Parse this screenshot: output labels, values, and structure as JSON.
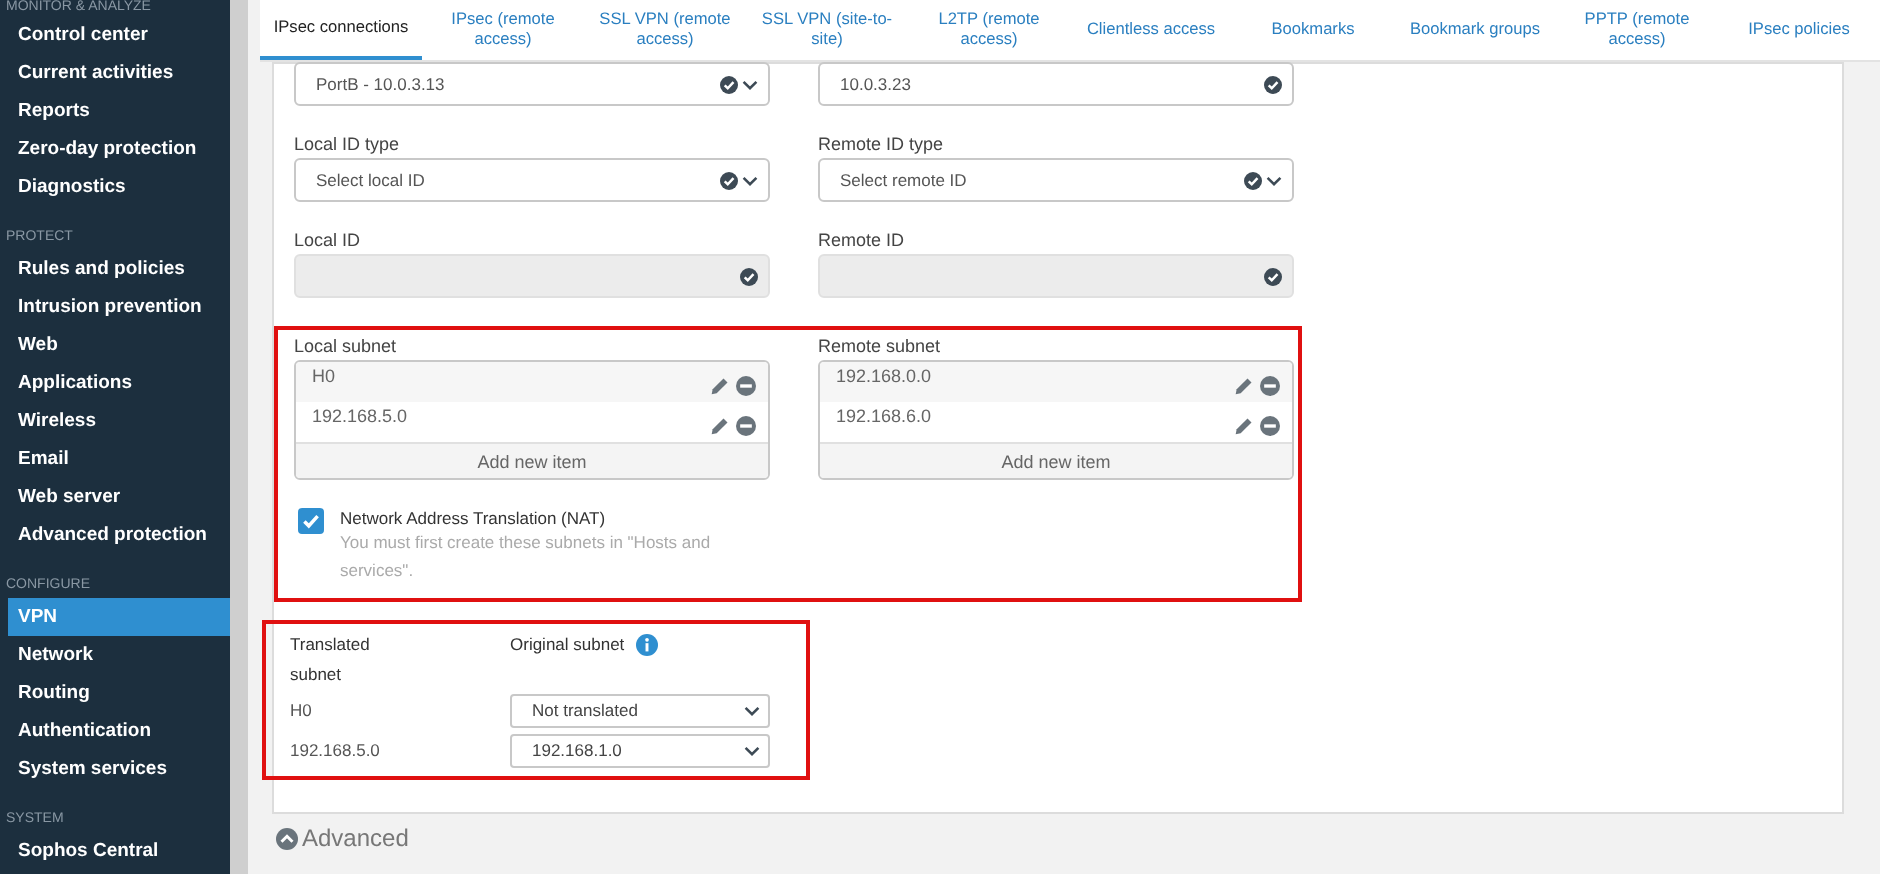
{
  "sidebar": {
    "sections": [
      {
        "heading": "MONITOR & ANALYZE",
        "items": [
          {
            "label": "Control center",
            "selected": false
          },
          {
            "label": "Current activities",
            "selected": false
          },
          {
            "label": "Reports",
            "selected": false
          },
          {
            "label": "Zero-day protection",
            "selected": false
          },
          {
            "label": "Diagnostics",
            "selected": false
          }
        ]
      },
      {
        "heading": "PROTECT",
        "items": [
          {
            "label": "Rules and policies",
            "selected": false
          },
          {
            "label": "Intrusion prevention",
            "selected": false
          },
          {
            "label": "Web",
            "selected": false
          },
          {
            "label": "Applications",
            "selected": false
          },
          {
            "label": "Wireless",
            "selected": false
          },
          {
            "label": "Email",
            "selected": false
          },
          {
            "label": "Web server",
            "selected": false
          },
          {
            "label": "Advanced protection",
            "selected": false
          }
        ]
      },
      {
        "heading": "CONFIGURE",
        "items": [
          {
            "label": "VPN",
            "selected": true
          },
          {
            "label": "Network",
            "selected": false
          },
          {
            "label": "Routing",
            "selected": false
          },
          {
            "label": "Authentication",
            "selected": false
          },
          {
            "label": "System services",
            "selected": false
          }
        ]
      },
      {
        "heading": "SYSTEM",
        "items": [
          {
            "label": "Sophos Central",
            "selected": false
          }
        ]
      }
    ]
  },
  "tabs": [
    {
      "label": "IPsec connections",
      "selected": true
    },
    {
      "label": "IPsec (remote access)",
      "selected": false
    },
    {
      "label": "SSL VPN (remote access)",
      "selected": false
    },
    {
      "label": "SSL VPN (site-to-site)",
      "selected": false
    },
    {
      "label": "L2TP (remote access)",
      "selected": false
    },
    {
      "label": "Clientless access",
      "selected": false
    },
    {
      "label": "Bookmarks",
      "selected": false
    },
    {
      "label": "Bookmark groups",
      "selected": false
    },
    {
      "label": "PPTP (remote access)",
      "selected": false
    },
    {
      "label": "IPsec policies",
      "selected": false
    }
  ],
  "form_rows": [
    [
      {
        "kind": "select",
        "value": "PortB - 10.0.3.13",
        "disabled": false
      },
      {
        "kind": "text",
        "value": "10.0.3.23",
        "disabled": false
      }
    ],
    [
      {
        "kind": "select",
        "label": "Local ID type",
        "value": "Select local ID",
        "disabled": false
      },
      {
        "kind": "select",
        "label": "Remote ID type",
        "value": "Select remote ID",
        "disabled": false
      }
    ],
    [
      {
        "kind": "text",
        "label": "Local ID",
        "disabled": true
      },
      {
        "kind": "text",
        "label": "Remote ID",
        "disabled": true
      }
    ]
  ],
  "subnets": [
    {
      "label": "Local subnet",
      "items": [
        "H0",
        "192.168.5.0"
      ],
      "add_label": "Add new item"
    },
    {
      "label": "Remote subnet",
      "items": [
        "192.168.0.0",
        "192.168.6.0"
      ],
      "add_label": "Add new item"
    }
  ],
  "nat": {
    "label": "Network Address Translation (NAT)",
    "checked": true,
    "hint": "You must first create these subnets in \"Hosts and services\"."
  },
  "translation": {
    "columns": [
      "Translated subnet",
      "Original subnet"
    ],
    "rows": [
      {
        "subnet": "H0",
        "original": "Not translated"
      },
      {
        "subnet": "192.168.5.0",
        "original": "192.168.1.0"
      }
    ]
  },
  "advanced": {
    "label": "Advanced",
    "expanded": true
  }
}
